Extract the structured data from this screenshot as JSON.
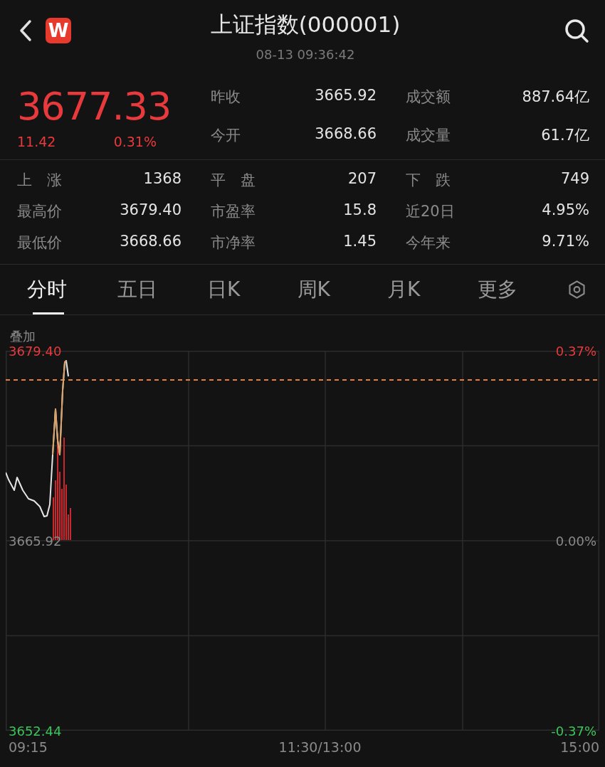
{
  "header": {
    "logo": "W",
    "title": "上证指数(000001)",
    "time": "08-13 09:36:42"
  },
  "quote": {
    "price": "3677.33",
    "change": "11.42",
    "change_pct": "0.31%",
    "stats": [
      {
        "label": "昨收",
        "value": "3665.92"
      },
      {
        "label": "成交额",
        "value": "887.64亿"
      },
      {
        "label": "今开",
        "value": "3668.66"
      },
      {
        "label": "成交量",
        "value": "61.7亿"
      }
    ]
  },
  "stats": [
    {
      "label": "上　涨",
      "value": "1368"
    },
    {
      "label": "平　盘",
      "value": "207"
    },
    {
      "label": "下　跌",
      "value": "749"
    },
    {
      "label": "最高价",
      "value": "3679.40"
    },
    {
      "label": "市盈率",
      "value": "15.8"
    },
    {
      "label": "近20日",
      "value": "4.95%"
    },
    {
      "label": "最低价",
      "value": "3668.66"
    },
    {
      "label": "市净率",
      "value": "1.45"
    },
    {
      "label": "今年来",
      "value": "9.71%"
    }
  ],
  "tabs": [
    {
      "label": "分时",
      "selected": true
    },
    {
      "label": "五日",
      "selected": false
    },
    {
      "label": "日K",
      "selected": false
    },
    {
      "label": "周K",
      "selected": false
    },
    {
      "label": "月K",
      "selected": false
    },
    {
      "label": "更多",
      "selected": false
    }
  ],
  "overlay_label": "叠加",
  "chart": {
    "price_labels": [
      "3679.40",
      "3665.92",
      "3652.44"
    ],
    "percent_labels": [
      "0.37%",
      "0.00%",
      "-0.37%"
    ],
    "time_labels": [
      "09:15",
      "11:30/13:00",
      "15:00"
    ]
  }
}
